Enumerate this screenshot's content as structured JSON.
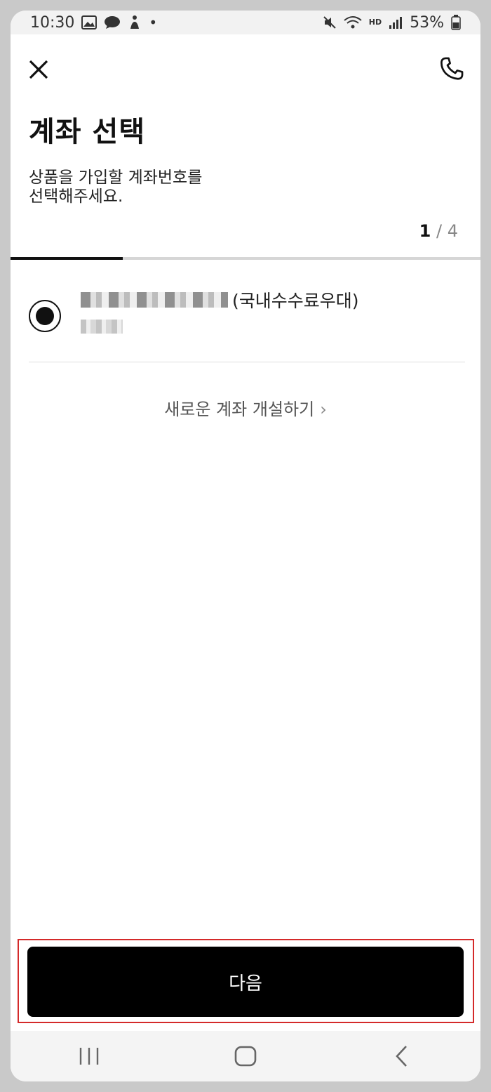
{
  "status_bar": {
    "time": "10:30",
    "battery": "53%",
    "left_icons": [
      "gallery-icon",
      "chat-bubble-icon",
      "accessibility-icon",
      "notification-dot-icon"
    ],
    "right_icons": [
      "mute-icon",
      "wifi-icon",
      "hd-voice-icon",
      "signal-icon",
      "battery-icon"
    ],
    "hd_badge": "HD"
  },
  "header": {
    "close_icon": "close-icon",
    "phone_icon": "phone-icon",
    "title": "계좌 선택",
    "description": "상품을 가입할 계좌번호를\n선택해주세요.",
    "step_current": "1",
    "step_total": "/ 4",
    "progress": 0.25
  },
  "account": {
    "selected": true,
    "name_suffix": "(국내수수료우대)"
  },
  "new_account_link": {
    "label": "새로운 계좌 개설하기",
    "chevron": "›"
  },
  "next_button": {
    "label": "다음"
  },
  "nav_bar": {
    "items": [
      "recent-apps-icon",
      "home-icon",
      "back-icon"
    ]
  },
  "colors": {
    "primary": "#000000",
    "highlight_border": "#d42a2a",
    "progress_track": "#d6d6d6"
  }
}
